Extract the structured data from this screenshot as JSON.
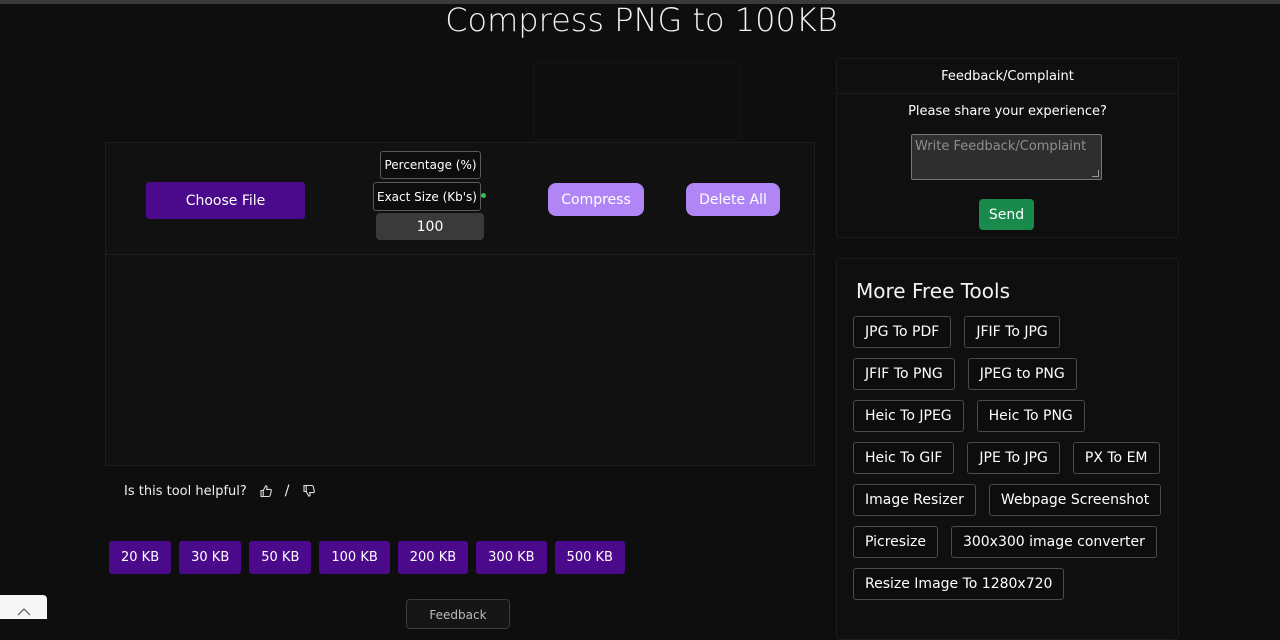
{
  "page": {
    "title": "Compress PNG to 100KB"
  },
  "tool": {
    "choose_file": "Choose File",
    "options": {
      "percentage": "Percentage (%)",
      "exact_size": "Exact Size (Kb's)"
    },
    "size_value": "100",
    "compress": "Compress",
    "delete_all": "Delete All"
  },
  "helpful": {
    "question": "Is this tool helpful?",
    "separator": "/"
  },
  "sizes": [
    "20 KB",
    "30 KB",
    "50 KB",
    "100 KB",
    "200 KB",
    "300 KB",
    "500 KB"
  ],
  "feedback_tab": {
    "label": "Feedback"
  },
  "feedback": {
    "heading": "Feedback/Complaint",
    "prompt": "Please share your experience?",
    "placeholder": "Write Feedback/Complaint",
    "send": "Send"
  },
  "more_tools": {
    "title": "More Free Tools",
    "items": [
      "JPG To PDF",
      "JFIF To JPG",
      "JFIF To PNG",
      "JPEG to PNG",
      "Heic To JPEG",
      "Heic To PNG",
      "Heic To GIF",
      "JPE To JPG",
      "PX To EM",
      "Image Resizer",
      "Webpage Screenshot",
      "Picresize",
      "300x300 image converter",
      "Resize Image To 1280x720"
    ]
  },
  "colors": {
    "background": "#0e0e0e",
    "purple_dark": "#4b0a8c",
    "purple_light": "#b086f7",
    "green": "#198a4b",
    "status_dot": "#2fbf4f"
  },
  "icons": [
    "thumbs-up-icon",
    "thumbs-down-icon",
    "chevron-up-icon"
  ]
}
